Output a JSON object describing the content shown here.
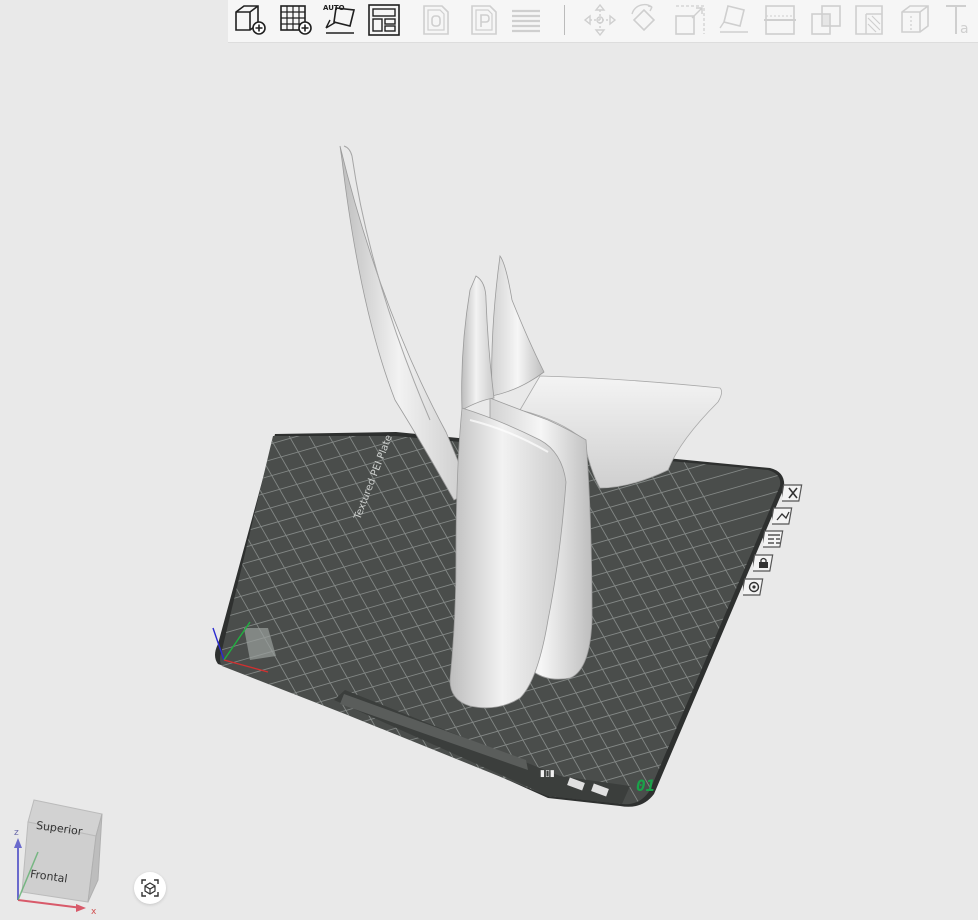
{
  "toolbar": {
    "tools": [
      {
        "name": "add-object-button",
        "icon": "cube-plus-icon",
        "enabled": true
      },
      {
        "name": "add-plate-button",
        "icon": "grid-plus-icon",
        "enabled": true
      },
      {
        "name": "auto-arrange-button",
        "icon": "auto-arrange-icon",
        "enabled": true,
        "label": "AUTO"
      },
      {
        "name": "plate-layout-button",
        "icon": "layout-icon",
        "enabled": true
      },
      {
        "name": "orient-button",
        "icon": "page-o-icon",
        "enabled": false
      },
      {
        "name": "plate-settings-button",
        "icon": "page-p-icon",
        "enabled": false
      },
      {
        "name": "layers-button",
        "icon": "layers-icon",
        "enabled": false
      },
      {
        "name": "move-button",
        "icon": "move-icon",
        "enabled": false
      },
      {
        "name": "rotate-button",
        "icon": "rotate-icon",
        "enabled": false
      },
      {
        "name": "scale-button",
        "icon": "scale-icon",
        "enabled": false
      },
      {
        "name": "lay-on-face-button",
        "icon": "lay-flat-icon",
        "enabled": false
      },
      {
        "name": "cut-button",
        "icon": "cut-icon",
        "enabled": false
      },
      {
        "name": "boolean-button",
        "icon": "boolean-icon",
        "enabled": false
      },
      {
        "name": "support-paint-button",
        "icon": "support-paint-icon",
        "enabled": false
      },
      {
        "name": "seam-paint-button",
        "icon": "seam-cube-icon",
        "enabled": false
      },
      {
        "name": "text-emboss-button",
        "icon": "text-icon",
        "enabled": false,
        "label": "Ta"
      }
    ]
  },
  "plate": {
    "number": "01",
    "side_label": "Textured PEI Plate",
    "colors": {
      "plate": "#4a4d4b",
      "grid": "#8d9290",
      "border": "#2d2f2e",
      "model": "#d9d9d9"
    },
    "side_buttons": [
      {
        "name": "plate-delete-button",
        "icon": "close-icon"
      },
      {
        "name": "plate-arrange-button",
        "icon": "arrange-icon"
      },
      {
        "name": "plate-orient-button",
        "icon": "orient-icon"
      },
      {
        "name": "plate-lock-button",
        "icon": "lock-icon"
      },
      {
        "name": "plate-settings-button",
        "icon": "gear-icon"
      }
    ]
  },
  "view_cube": {
    "top_label": "Superior",
    "front_label": "Frontal",
    "axis_z": "z",
    "axis_x": "x"
  },
  "fit_view_icon": "fit-view-icon"
}
